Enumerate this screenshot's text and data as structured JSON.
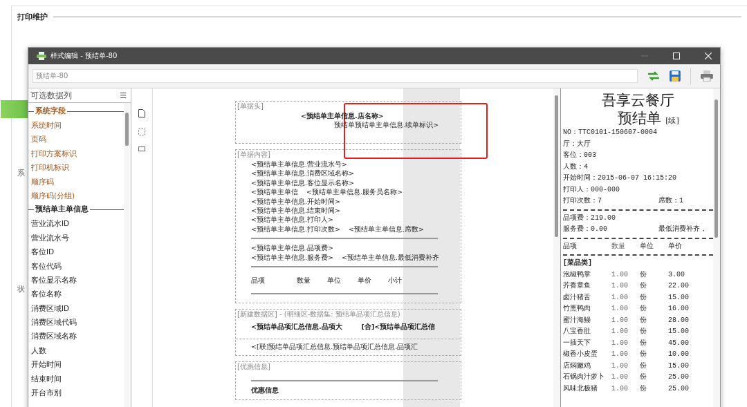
{
  "page": {
    "title": "打印维护",
    "behind_labels": [
      "系",
      "状"
    ]
  },
  "window": {
    "title": "样式编辑 - 预结单-80"
  },
  "toolbar": {
    "name_field": "预结单-80"
  },
  "field_list": {
    "title": "可选数据列",
    "menu_icon": "☰",
    "groups": [
      {
        "title": "系统字段",
        "color": "#a0561c",
        "items": [
          "系统时间",
          "页码",
          "打印方案标识",
          "打印机标识",
          "顺序码",
          "顺序码(分组)"
        ]
      },
      {
        "title": "预结单主单信息",
        "color": "#222222",
        "items": [
          "营业流水ID",
          "营业流水号",
          "客位ID",
          "客位代码",
          "客位显示名称",
          "客位名称",
          "消费区域ID",
          "消费区域代码",
          "消费区域名称",
          "人数",
          "开始时间",
          "结束时间",
          "开台市别"
        ]
      }
    ]
  },
  "designer": {
    "sections": [
      {
        "label": "[单据头]",
        "lines": [
          {
            "kind": "title",
            "texts": [
              "<预结单主单信息.店名称>"
            ]
          },
          {
            "kind": "subtitle",
            "texts": [
              "预结单预结单主单信息.续单标识>"
            ]
          }
        ]
      },
      {
        "label": "[单据内容]",
        "lines": [
          {
            "kind": "text",
            "texts": [
              "<预结单主单信息.营业流水号>"
            ]
          },
          {
            "kind": "text",
            "texts": [
              "<预结单主单信息.消费区域名称>"
            ]
          },
          {
            "kind": "text",
            "texts": [
              "<预结单主单信息.客位显示名称>"
            ]
          },
          {
            "kind": "pair",
            "texts": [
              "<预结单主单信",
              "<预结单主单信息.服务员名称>"
            ]
          },
          {
            "kind": "text",
            "texts": [
              "<预结单主单信息.开始时间>"
            ]
          },
          {
            "kind": "text",
            "texts": [
              "<预结单主单信息.结束时间>"
            ]
          },
          {
            "kind": "text",
            "texts": [
              "<预结单主单信息.打印人>"
            ]
          },
          {
            "kind": "pair",
            "texts": [
              "<预结单主单信息.打印次数>",
              "<预结单主单信息.席数>"
            ]
          },
          {
            "kind": "rule"
          },
          {
            "kind": "text",
            "texts": [
              "<预结单主单信息.品项费>"
            ]
          },
          {
            "kind": "pair",
            "texts": [
              "<预结单主单信息.服务费>",
              "<预结单主单信息.最低消费补齐"
            ]
          },
          {
            "kind": "rule"
          },
          {
            "kind": "columns",
            "texts": [
              "品项",
              "数量",
              "单位",
              "单价",
              "小计"
            ]
          },
          {
            "kind": "rule"
          }
        ]
      },
      {
        "label": "[新建数据区] - (明细区-数据集: 预结单品项汇总信息)",
        "lines": [
          {
            "kind": "boldpair",
            "texts": [
              "<预结单品项汇总信息.品项大",
              "[合]<预结单品项汇总信"
            ]
          },
          {
            "kind": "divider"
          },
          {
            "kind": "text",
            "texts": [
              "<[联]预结单品项汇总信息.预结单品项汇总信息.品项汇"
            ]
          }
        ]
      },
      {
        "label": "[优惠信息]",
        "lines": [
          {
            "kind": "rule"
          },
          {
            "kind": "bold",
            "texts": [
              "优惠信息"
            ]
          }
        ]
      }
    ]
  },
  "preview": {
    "shop": "吾享云餐厅",
    "doc": "预结单",
    "tag": "[续]",
    "lines": [
      {
        "kind": "text",
        "texts": [
          "NO：TTC0101-150607-0004"
        ]
      },
      {
        "kind": "text",
        "texts": [
          "厅：大厅"
        ]
      },
      {
        "kind": "text",
        "texts": [
          "客位：003"
        ]
      },
      {
        "kind": "text",
        "texts": [
          "人数：4"
        ]
      },
      {
        "kind": "text",
        "texts": [
          "开始时间：2015-06-07 16:15:20"
        ]
      },
      {
        "kind": "text",
        "texts": [
          "打印人：000-000"
        ]
      },
      {
        "kind": "pair",
        "texts": [
          "打印次数：7",
          "席数：1"
        ]
      },
      {
        "kind": "dash"
      },
      {
        "kind": "text",
        "texts": [
          "品项费：219.00"
        ]
      },
      {
        "kind": "pair",
        "texts": [
          "服务费：0.00",
          "最低消费补齐，"
        ]
      },
      {
        "kind": "dash"
      },
      {
        "kind": "row",
        "texts": [
          "品项",
          "数量",
          "单位",
          "单价"
        ]
      },
      {
        "kind": "dash"
      },
      {
        "kind": "bold",
        "texts": [
          "[菜品类]"
        ]
      },
      {
        "kind": "row",
        "texts": [
          "泡椒鸭掌",
          "1.00",
          "份",
          "3.00"
        ]
      },
      {
        "kind": "row",
        "texts": [
          "芥香章鱼",
          "1.00",
          "份",
          "22.00"
        ]
      },
      {
        "kind": "row",
        "texts": [
          "卤汁猪舌",
          "1.00",
          "份",
          "15.00"
        ]
      },
      {
        "kind": "row",
        "texts": [
          "竹熏鸭肉",
          "1.00",
          "份",
          "16.00"
        ]
      },
      {
        "kind": "row",
        "texts": [
          "蜜汁海鳗",
          "1.00",
          "份",
          "28.00"
        ]
      },
      {
        "kind": "row",
        "texts": [
          "八宝香肚",
          "1.00",
          "份",
          "15.00"
        ]
      },
      {
        "kind": "row",
        "texts": [
          "一插天下",
          "1.00",
          "份",
          "45.00"
        ]
      },
      {
        "kind": "row",
        "texts": [
          "椒香小皮蛋",
          "1.00",
          "份",
          "10.00"
        ]
      },
      {
        "kind": "row",
        "texts": [
          "店焖嫩鸡",
          "1.00",
          "份",
          "15.00"
        ]
      },
      {
        "kind": "row",
        "texts": [
          "石锅肉汁萝卜",
          "1.00",
          "份",
          "25.00"
        ]
      },
      {
        "kind": "row",
        "texts": [
          "风味北极猪",
          "1.00",
          "份",
          "25.00"
        ]
      }
    ]
  }
}
